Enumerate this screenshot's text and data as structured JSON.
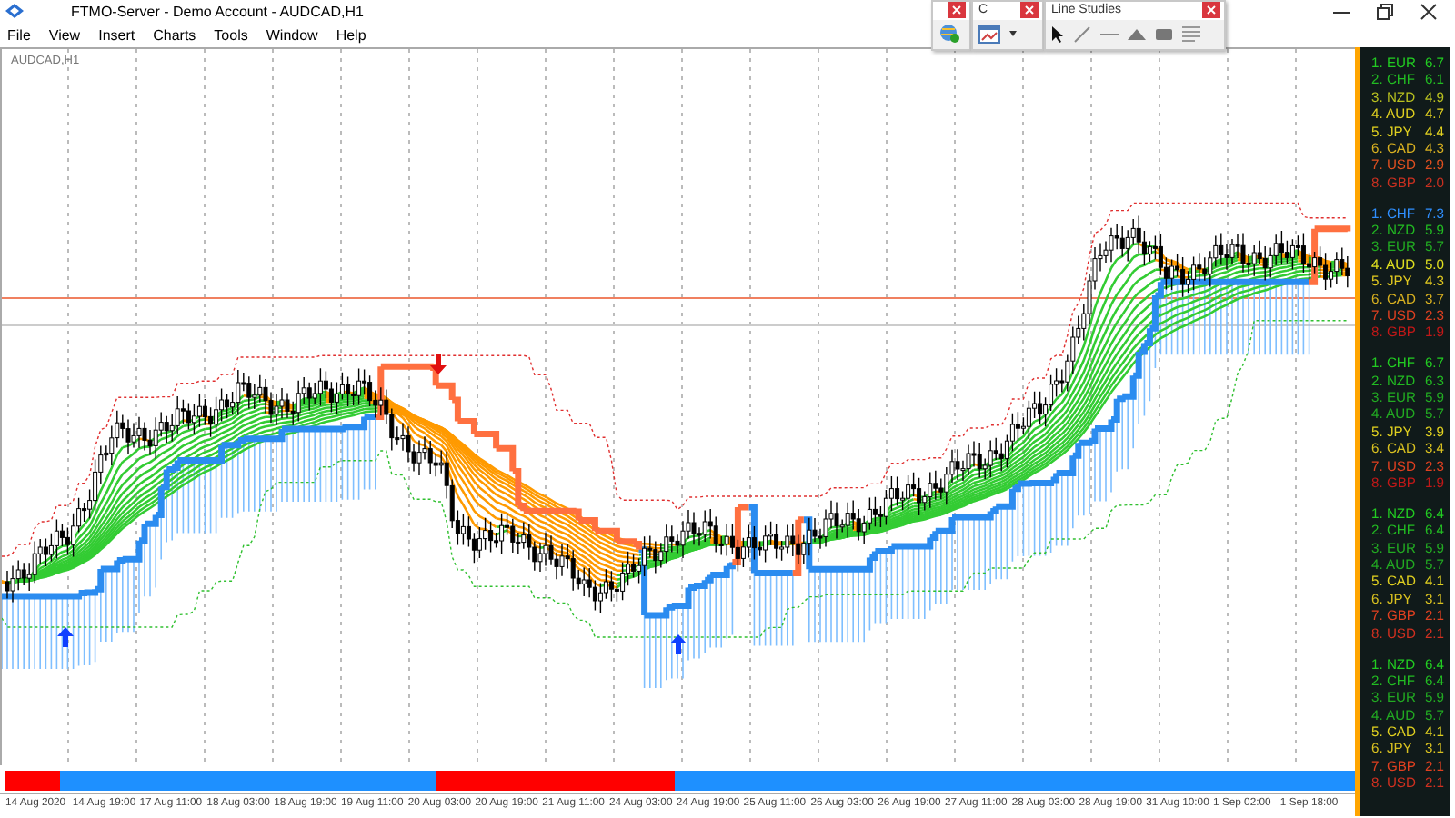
{
  "window": {
    "title": "FTMO-Server - Demo Account - AUDCAD,H1"
  },
  "menu": [
    "File",
    "View",
    "Insert",
    "Charts",
    "Tools",
    "Window",
    "Help"
  ],
  "toolbars": [
    {
      "kind": "market"
    },
    {
      "kind": "charts",
      "title": "C"
    },
    {
      "kind": "line_studies",
      "title": "Line Studies"
    }
  ],
  "chart": {
    "symbol": "AUDCAD,H1"
  },
  "strength_groups": [
    {
      "items": [
        {
          "label": "1. EUR",
          "value": "6.7",
          "color": "#22cc22"
        },
        {
          "label": "2. CHF",
          "value": "6.1",
          "color": "#22bb22"
        },
        {
          "label": "3. NZD",
          "value": "4.9",
          "color": "#b8c020"
        },
        {
          "label": "4. AUD",
          "value": "4.7",
          "color": "#e0d020"
        },
        {
          "label": "5. JPY",
          "value": "4.4",
          "color": "#e0d020"
        },
        {
          "label": "6. CAD",
          "value": "4.3",
          "color": "#d8b020"
        },
        {
          "label": "7. USD",
          "value": "2.9",
          "color": "#e05020"
        },
        {
          "label": "8. GBP",
          "value": "2.0",
          "color": "#c83020"
        }
      ]
    },
    {
      "items": [
        {
          "label": "1. CHF",
          "value": "7.3",
          "color": "#2f8fff"
        },
        {
          "label": "2. NZD",
          "value": "5.9",
          "color": "#22bb22"
        },
        {
          "label": "3. EUR",
          "value": "5.7",
          "color": "#22aa22"
        },
        {
          "label": "4. AUD",
          "value": "5.0",
          "color": "#e0e020"
        },
        {
          "label": "5. JPY",
          "value": "4.3",
          "color": "#e0c820"
        },
        {
          "label": "6. CAD",
          "value": "3.7",
          "color": "#d8b020"
        },
        {
          "label": "7. USD",
          "value": "2.3",
          "color": "#e04020"
        },
        {
          "label": "8. GBP",
          "value": "1.9",
          "color": "#c01818"
        }
      ]
    },
    {
      "items": [
        {
          "label": "1. CHF",
          "value": "6.7",
          "color": "#22cc22"
        },
        {
          "label": "2. NZD",
          "value": "6.3",
          "color": "#22bb22"
        },
        {
          "label": "3. EUR",
          "value": "5.9",
          "color": "#22aa22"
        },
        {
          "label": "4. AUD",
          "value": "5.7",
          "color": "#22aa22"
        },
        {
          "label": "5. JPY",
          "value": "3.9",
          "color": "#e0d020"
        },
        {
          "label": "6. CAD",
          "value": "3.4",
          "color": "#d8c020"
        },
        {
          "label": "7. USD",
          "value": "2.3",
          "color": "#e04020"
        },
        {
          "label": "8. GBP",
          "value": "1.9",
          "color": "#c01818"
        }
      ]
    },
    {
      "items": [
        {
          "label": "1. NZD",
          "value": "6.4",
          "color": "#22cc22"
        },
        {
          "label": "2. CHF",
          "value": "6.4",
          "color": "#22bb22"
        },
        {
          "label": "3. EUR",
          "value": "5.9",
          "color": "#22aa22"
        },
        {
          "label": "4. AUD",
          "value": "5.7",
          "color": "#22aa22"
        },
        {
          "label": "5. CAD",
          "value": "4.1",
          "color": "#e0d020"
        },
        {
          "label": "6. JPY",
          "value": "3.1",
          "color": "#d8c020"
        },
        {
          "label": "7. GBP",
          "value": "2.1",
          "color": "#e04020"
        },
        {
          "label": "8. USD",
          "value": "2.1",
          "color": "#d03020"
        }
      ]
    },
    {
      "items": [
        {
          "label": "1. NZD",
          "value": "6.4",
          "color": "#22cc22"
        },
        {
          "label": "2. CHF",
          "value": "6.4",
          "color": "#22bb22"
        },
        {
          "label": "3. EUR",
          "value": "5.9",
          "color": "#22aa22"
        },
        {
          "label": "4. AUD",
          "value": "5.7",
          "color": "#22aa22"
        },
        {
          "label": "5. CAD",
          "value": "4.1",
          "color": "#e0d020"
        },
        {
          "label": "6. JPY",
          "value": "3.1",
          "color": "#d8c020"
        },
        {
          "label": "7. GBP",
          "value": "2.1",
          "color": "#e04020"
        },
        {
          "label": "8. USD",
          "value": "2.1",
          "color": "#d03020"
        }
      ]
    }
  ],
  "trend_bar": [
    {
      "color": "#ff0000"
    },
    {
      "color": "#1e90ff"
    },
    {
      "color": "#ff0000"
    },
    {
      "color": "#1e90ff"
    }
  ],
  "time_axis": [
    "14 Aug 2020",
    "14 Aug 19:00",
    "17 Aug 11:00",
    "18 Aug 03:00",
    "18 Aug 19:00",
    "19 Aug 11:00",
    "20 Aug 03:00",
    "20 Aug 19:00",
    "21 Aug 11:00",
    "24 Aug 03:00",
    "24 Aug 19:00",
    "25 Aug 11:00",
    "26 Aug 03:00",
    "26 Aug 19:00",
    "27 Aug 11:00",
    "28 Aug 03:00",
    "28 Aug 19:00",
    "31 Aug 10:00",
    "1 Sep 02:00",
    "1 Sep 18:00"
  ]
}
